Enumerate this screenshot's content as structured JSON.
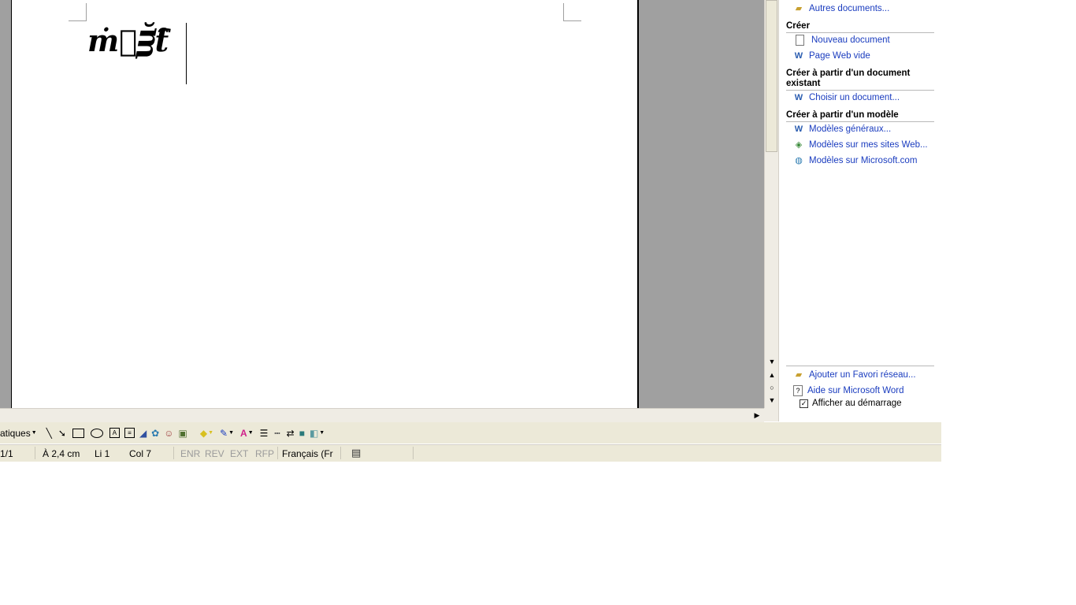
{
  "document": {
    "text": "ṁ᪽ᴟ̆ƭ̑"
  },
  "taskpane": {
    "top_link": "Autres documents...",
    "sections": {
      "creer": "Créer",
      "creer_existant": "Créer à partir d'un document existant",
      "creer_modele": "Créer à partir d'un modèle"
    },
    "links": {
      "nouveau": "Nouveau document",
      "page_web": "Page Web vide",
      "choisir": "Choisir un document...",
      "modeles_generaux": "Modèles généraux...",
      "modeles_sites": "Modèles sur mes sites Web...",
      "modeles_ms": "Modèles sur Microsoft.com",
      "favori": "Ajouter un Favori réseau...",
      "aide": "Aide sur Microsoft Word"
    },
    "checkbox_label": "Afficher au démarrage",
    "checkbox_checked": true
  },
  "drawbar": {
    "autoshapes_label": "atiques"
  },
  "status": {
    "page": "1/1",
    "position": "À  2,4 cm",
    "line": "Li  1",
    "col": "Col  7",
    "enr": "ENR",
    "rev": "REV",
    "ext": "EXT",
    "rfp": "RFP",
    "language": "Français (Fr"
  },
  "colors": {
    "link": "#1a3cbf",
    "toolbar_bg": "#ece9d8",
    "workspace_bg": "#a0a0a0"
  }
}
